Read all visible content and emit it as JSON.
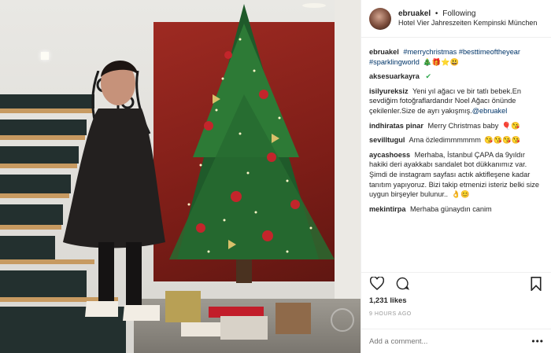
{
  "header": {
    "username": "ebruakel",
    "separator": "•",
    "follow_status": "Following",
    "location": "Hotel Vier Jahreszeiten Kempinski München"
  },
  "comments": [
    {
      "user": "ebruakel",
      "parts": [
        "#merrychristmas",
        "#besttimeoftheyear",
        "#sparklingworld"
      ],
      "emoji": "🎄🎁⭐😃"
    },
    {
      "user": "aksesuarkayra",
      "text": "",
      "emoji": "✔"
    },
    {
      "user": "isilyureksiz",
      "text": "Yeni yıl ağacı ve bir tatlı bebek.En sevdiğim fotoğraflardandır Noel Ağacı önünde çekilenler.Size de ayrı yakışmış.",
      "mention": "@ebruakel"
    },
    {
      "user": "indhiratas pinar",
      "text": "Merry Christmas baby",
      "emoji": "🎈😘"
    },
    {
      "user": "sevilltugul",
      "text": "Ama özledimmmmmm",
      "emoji": "😘😘😘😘"
    },
    {
      "user": "aycashoess",
      "text": "Merhaba, İstanbul ÇAPA da 9yıldır hakiki deri ayakkabı sandalet bot dükkanımız var. Şimdi de instagram sayfası actık aktifleşene kadar tanıtım yapıyoruz. Bizi takip etmenizi isteriz belki size uygun birşeyler bulunur..",
      "emoji": "👌😊"
    },
    {
      "user": "mekintirpa",
      "text": "Merhaba günaydın canim"
    }
  ],
  "actions": {
    "like_icon": "heart-icon",
    "comment_icon": "comment-icon",
    "save_icon": "bookmark-icon"
  },
  "likes": "1,231 likes",
  "time": "9 HOURS AGO",
  "add_comment": {
    "placeholder": "Add a comment...",
    "more": "•••"
  }
}
